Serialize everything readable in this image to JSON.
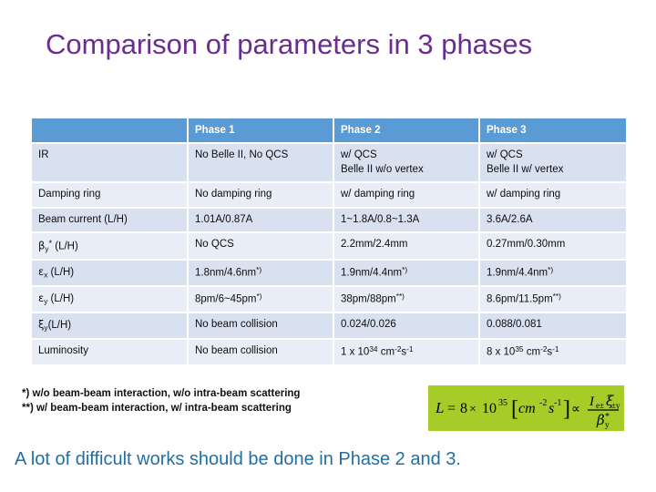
{
  "slide": {
    "title": "Comparison of parameters in 3 phases",
    "title_color": "#6B2D8F",
    "bottom_note": "A lot of difficult works should be done in Phase 2 and 3.",
    "bottom_note_color": "#1F6FA5"
  },
  "table": {
    "header_bg": "#5B9BD5",
    "row_odd_bg": "#D9E1F0",
    "row_even_bg": "#E8EDF6",
    "columns": [
      "",
      "Phase 1",
      "Phase 2",
      "Phase 3"
    ],
    "rows": [
      {
        "label": "IR",
        "label_html": "IR",
        "phase1": "No Belle II, No QCS",
        "phase2_line1": "w/ QCS",
        "phase2_line2": "Belle II w/o vertex",
        "phase3_line1": "w/ QCS",
        "phase3_line2": "Belle II w/ vertex"
      },
      {
        "label": "Damping ring",
        "phase1": "No damping ring",
        "phase2": "w/ damping ring",
        "phase3": "w/ damping ring"
      },
      {
        "label": "Beam current (L/H)",
        "phase1": "1.01A/0.87A",
        "phase2": "1~1.8A/0.8~1.3A",
        "phase3": "3.6A/2.6A"
      },
      {
        "label": "βy* (L/H)",
        "label_symbol": "β",
        "label_sub": "y",
        "label_star": "*",
        "label_rest": " (L/H)",
        "phase1": "No QCS",
        "phase2": "2.2mm/2.4mm",
        "phase3": "0.27mm/0.30mm"
      },
      {
        "label": "εx (L/H)",
        "label_symbol": "ε",
        "label_sub": "x",
        "label_star": "",
        "label_rest": " (L/H)",
        "phase1_value": "1.8nm/4.6nm",
        "phase1_note": "*)",
        "phase2_value": "1.9nm/4.4nm",
        "phase2_note": "*)",
        "phase3_value": "1.9nm/4.4nm",
        "phase3_note": "*)"
      },
      {
        "label": "εy (L/H)",
        "label_symbol": "ε",
        "label_sub": "y",
        "label_star": "",
        "label_rest": " (L/H)",
        "phase1_value": "8pm/6~45pm",
        "phase1_note": "*)",
        "phase2_value": "38pm/88pm",
        "phase2_note": "**)",
        "phase3_value": "8.6pm/11.5pm",
        "phase3_note": "**)"
      },
      {
        "label": "ξy(L/H)",
        "label_symbol": "ξ",
        "label_sub": "y",
        "label_star": "",
        "label_rest": "(L/H)",
        "phase1": "No beam collision",
        "phase2": "0.024/0.026",
        "phase3": "0.088/0.081"
      },
      {
        "label": "Luminosity",
        "phase1": "No beam collision",
        "phase2_mantissa": "1 x 10",
        "phase2_exp": "34",
        "phase2_unit_cm": " cm",
        "phase2_unit_cm_exp": "-2",
        "phase2_unit_s": "s",
        "phase2_unit_s_exp": "-1",
        "phase3_mantissa": "8 x 10",
        "phase3_exp": "35",
        "phase3_unit_cm": " cm",
        "phase3_unit_cm_exp": "-2",
        "phase3_unit_s": "s",
        "phase3_unit_s_exp": "-1"
      }
    ]
  },
  "footnotes": {
    "line1": "*) w/o beam-beam interaction, w/o intra-beam scattering",
    "line2": "**) w/ beam-beam interaction, w/ intra-beam scattering"
  },
  "formula": {
    "background": "#A5CC27",
    "text": "L = 8 × 10^35 [cm^-2 s^-1] ∝ I_e± ξ_±y / β_y*",
    "lhs": "L",
    "equals": "=",
    "coefficient": "8",
    "times": "×",
    "base": "10",
    "exponent": "35",
    "bracket_open": "[",
    "unit_cm": "cm",
    "unit_cm_exp": "-2",
    "unit_s": "s",
    "unit_s_exp": "-1",
    "bracket_close": "]",
    "proportional": "∝",
    "numer_I": "I",
    "numer_I_sub": "e±",
    "numer_xi": "ξ",
    "numer_xi_sub": "±y",
    "denom_beta": "β",
    "denom_beta_sub": "y",
    "denom_beta_star": "*"
  }
}
